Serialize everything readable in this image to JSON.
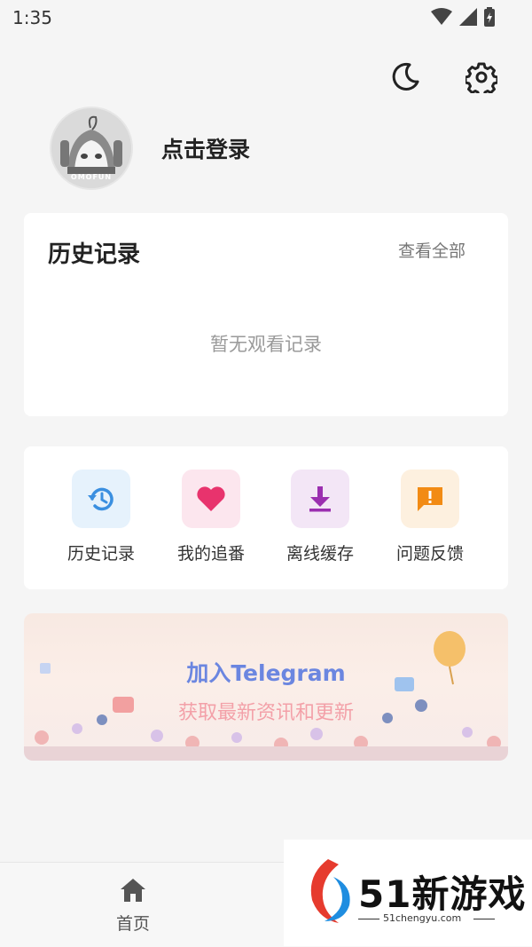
{
  "status": {
    "time": "1:35"
  },
  "header": {
    "theme_icon": "moon-icon",
    "settings_icon": "gear-icon"
  },
  "profile": {
    "avatar_text": "OMOFUN",
    "login_label": "点击登录"
  },
  "history": {
    "title": "历史记录",
    "view_all": "查看全部",
    "empty": "暂无观看记录"
  },
  "shortcuts": [
    {
      "label": "历史记录",
      "icon": "history-icon",
      "bg": "#e6f2fc",
      "color": "#3a8fe0"
    },
    {
      "label": "我的追番",
      "icon": "heart-icon",
      "bg": "#fce6ee",
      "color": "#e8336d"
    },
    {
      "label": "离线缓存",
      "icon": "download-icon",
      "bg": "#f3e6f6",
      "color": "#9b2fb0"
    },
    {
      "label": "问题反馈",
      "icon": "feedback-icon",
      "bg": "#fdf0df",
      "color": "#f28b14"
    }
  ],
  "banner": {
    "title": "加入Telegram",
    "subtitle": "获取最新资讯和更新"
  },
  "nav": {
    "home_label": "首页",
    "home_icon": "home-icon"
  },
  "watermark": {
    "title": "51新游戏",
    "url": "51chengyu.com"
  }
}
